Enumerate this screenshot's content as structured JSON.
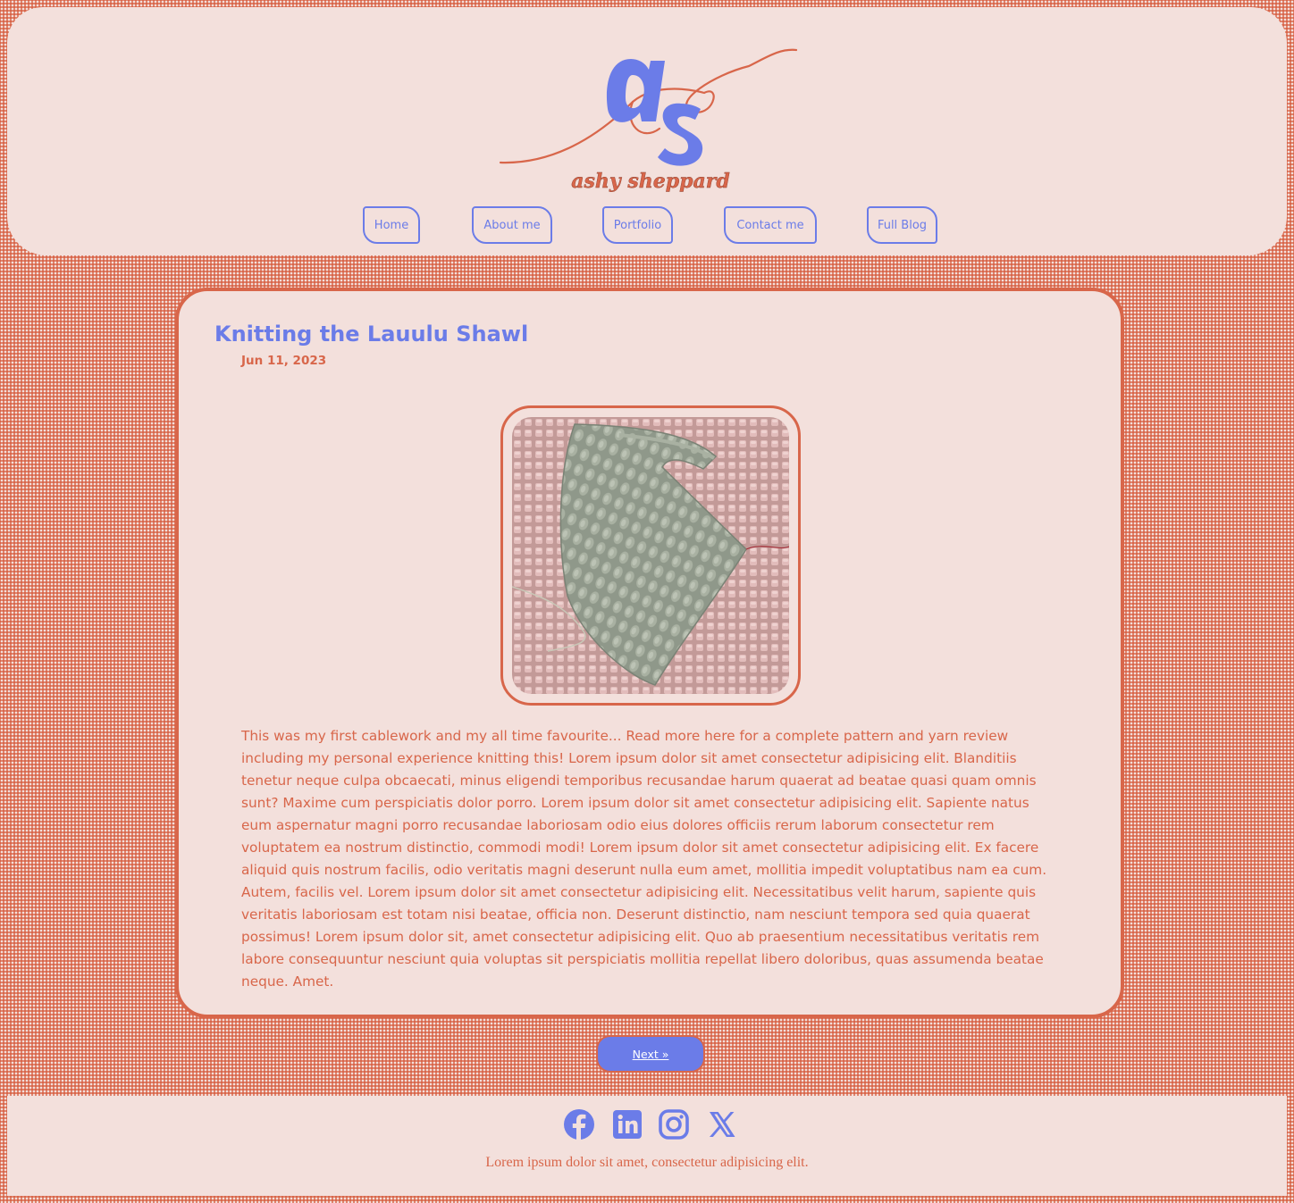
{
  "site": {
    "logo_text": "ashy sheppard",
    "logo_monogram": "aS"
  },
  "nav": {
    "items": [
      {
        "label": "Home"
      },
      {
        "label": "About me"
      },
      {
        "label": "Portfolio"
      },
      {
        "label": "Contact me"
      },
      {
        "label": "Full Blog"
      }
    ]
  },
  "post": {
    "title": "Knitting the Lauulu Shawl",
    "date": "Jun 11, 2023",
    "body": "This was my first cablework and my all time favourite... Read more here for a complete pattern and yarn review including my personal experience knitting this! Lorem ipsum dolor sit amet consectetur adipisicing elit. Blanditiis tenetur neque culpa obcaecati, minus eligendi temporibus recusandae harum quaerat ad beatae quasi quam omnis sunt? Maxime cum perspiciatis dolor porro. Lorem ipsum dolor sit amet consectetur adipisicing elit. Sapiente natus eum aspernatur magni porro recusandae laboriosam odio eius dolores officiis rerum laborum consectetur rem voluptatem ea nostrum distinctio, commodi modi! Lorem ipsum dolor sit amet consectetur adipisicing elit. Ex facere aliquid quis nostrum facilis, odio veritatis magni deserunt nulla eum amet, mollitia impedit voluptatibus nam ea cum. Autem, facilis vel. Lorem ipsum dolor sit amet consectetur adipisicing elit. Necessitatibus velit harum, sapiente quis veritatis laboriosam est totam nisi beatae, officia non. Deserunt distinctio, nam nesciunt tempora sed quia quaerat possimus! Lorem ipsum dolor sit, amet consectetur adipisicing elit. Quo ab praesentium necessitatibus veritatis rem labore consequuntur nesciunt quia voluptas sit perspiciatis mollitia repellat libero doloribus, quas assumenda beatae neque. Amet."
  },
  "pagination": {
    "next_label": "Next »"
  },
  "footer": {
    "social": [
      {
        "icon": "facebook-icon"
      },
      {
        "icon": "linkedin-icon"
      },
      {
        "icon": "instagram-icon"
      },
      {
        "icon": "x-twitter-icon"
      }
    ],
    "text": "Lorem ipsum dolor sit amet, consectetur adipisicing elit."
  },
  "colors": {
    "accent": "#6b7ce8",
    "brand": "#d8664a",
    "background": "#f3e0dc"
  }
}
